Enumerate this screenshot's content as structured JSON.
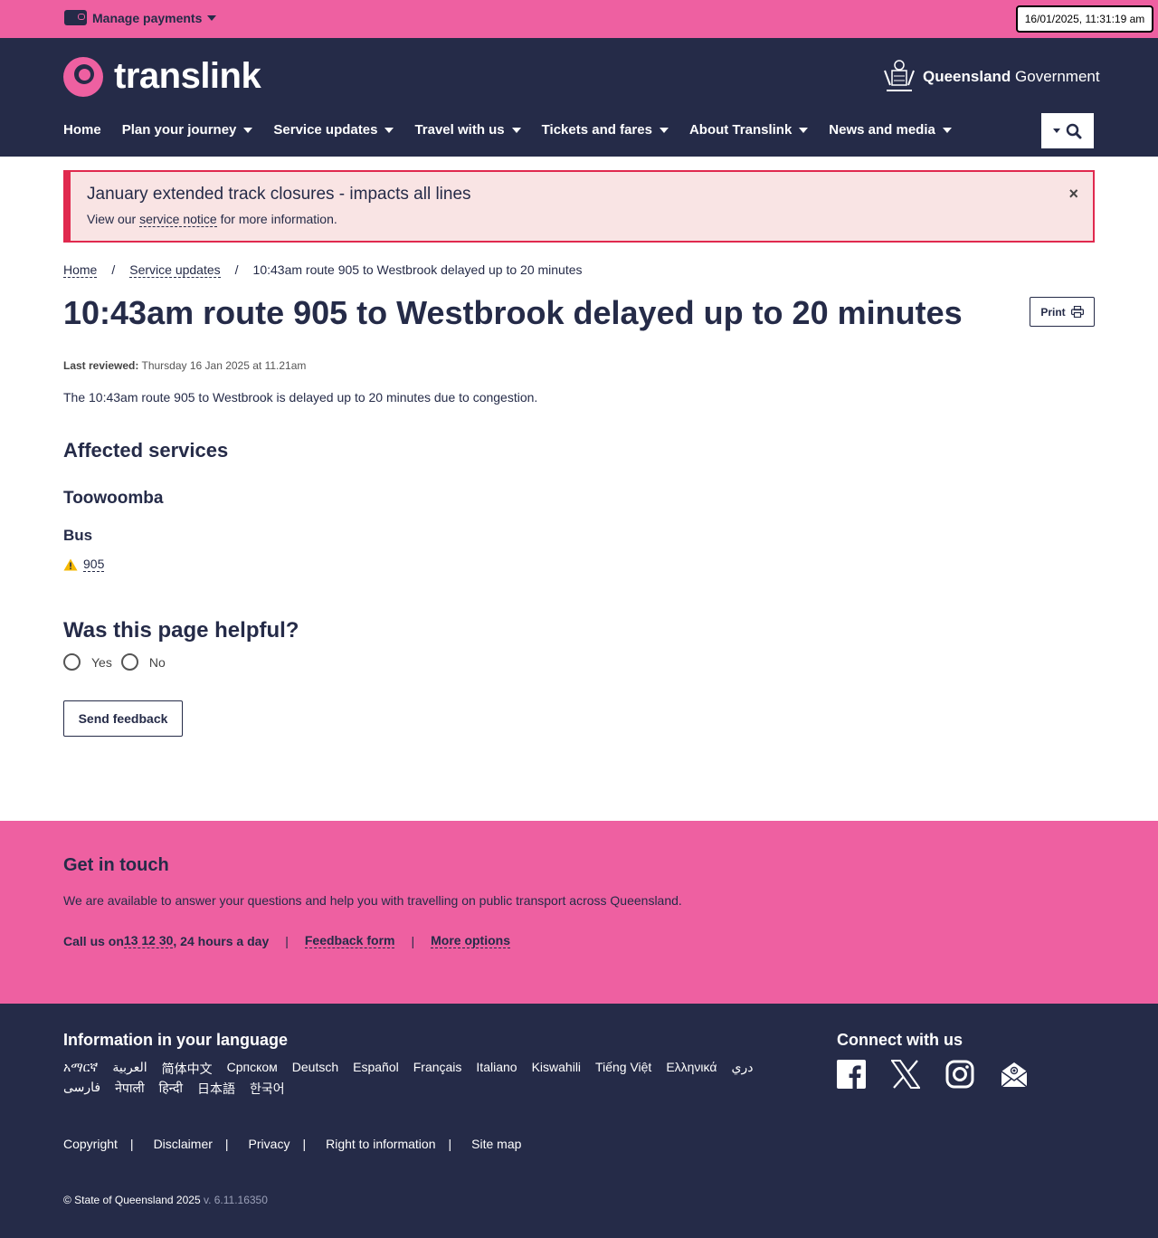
{
  "topbar": {
    "manage_payments": "Manage payments",
    "timestamp": "16/01/2025, 11:31:19 am"
  },
  "header": {
    "logo_text": "translink",
    "gov_bold": "Queensland",
    "gov_text": " Government",
    "nav": [
      "Home",
      "Plan your journey",
      "Service updates",
      "Travel with us",
      "Tickets and fares",
      "About Translink",
      "News and media"
    ]
  },
  "alert": {
    "title": "January extended track closures - impacts all lines",
    "body_prefix": "View our ",
    "body_link": "service notice",
    "body_suffix": " for more information.",
    "close": "×"
  },
  "breadcrumb": {
    "home": "Home",
    "section": "Service updates",
    "current": "10:43am route 905 to Westbrook delayed up to 20 minutes",
    "separator": "/"
  },
  "page": {
    "title": "10:43am route 905 to Westbrook delayed up to 20 minutes",
    "print": "Print",
    "reviewed_label": "Last reviewed:",
    "reviewed_value": " Thursday 16 Jan 2025 at 11.21am",
    "description": "The 10:43am route 905 to Westbrook is delayed up to 20 minutes due to congestion.",
    "affected_heading": "Affected services",
    "region": "Toowoomba",
    "mode": "Bus",
    "route": "905"
  },
  "feedback": {
    "heading": "Was this page helpful?",
    "yes": "Yes",
    "no": "No",
    "send": "Send feedback"
  },
  "get_in_touch": {
    "title": "Get in touch",
    "body": "We are available to answer your questions and help you with travelling on public transport across Queensland.",
    "call_prefix": "Call us on ",
    "phone": "13 12 30",
    "call_suffix": ", 24 hours a day",
    "feedback_form": "Feedback form",
    "more_options": "More options",
    "pipe": "|"
  },
  "footer": {
    "lang_title": "Information in your language",
    "languages": [
      "አማርኛ",
      "العربية",
      "简体中文",
      "Српском",
      "Deutsch",
      "Español",
      "Français",
      "Italiano",
      "Kiswahili",
      "Tiếng Việt",
      "Ελληνικά",
      "دري",
      "فارسی",
      "नेपाली",
      "हिन्दी",
      "日本語",
      "한국어"
    ],
    "connect_title": "Connect with us",
    "socials": [
      "facebook-icon",
      "x-icon",
      "instagram-icon",
      "email-icon"
    ],
    "links": [
      "Copyright",
      "Disclaimer",
      "Privacy",
      "Right to information",
      "Site map"
    ],
    "copyright": "© State of Queensland 2025",
    "version": " v. 6.11.16350"
  },
  "colors": {
    "navy": "#252b48",
    "pink": "#ee60a1",
    "alert_red": "#e0294e",
    "alert_bg": "#f9e4e4"
  }
}
